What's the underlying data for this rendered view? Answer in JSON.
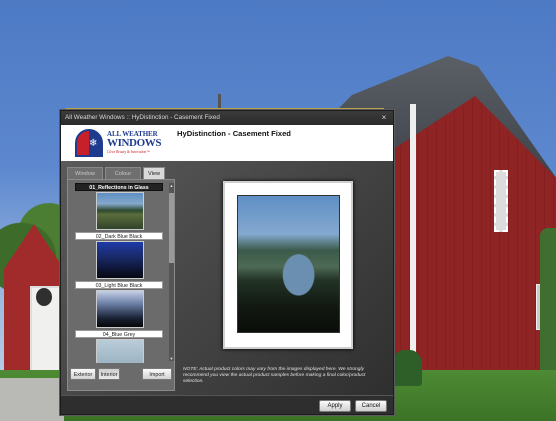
{
  "window": {
    "title": "All Weather Windows  ::  HyDistinction - Casement Fixed",
    "close_glyph": "×"
  },
  "header": {
    "logo_line1": "ALL WEATHER",
    "logo_line2": "WINDOWS",
    "logo_tagline": "Clear Beauty & Innovation™",
    "logo_icon": "snowflake-icon",
    "product_title": "HyDistinction - Casement Fixed"
  },
  "tabs": [
    {
      "label": "Window",
      "active": false
    },
    {
      "label": "Colour",
      "active": false
    },
    {
      "label": "View",
      "active": true
    }
  ],
  "views": [
    {
      "label": "01_Reflections in Glass",
      "selected": true
    },
    {
      "label": "02_Dark Blue Black",
      "selected": false
    },
    {
      "label": "03_Light Blue Black",
      "selected": false
    },
    {
      "label": "04_Blue Grey",
      "selected": false
    }
  ],
  "panel_buttons": {
    "exterior": "Exterior",
    "interior": "Interior",
    "import": "Import"
  },
  "note": "NOTE: Actual product colors may vary from the images displayed here. We strongly recommend you view the actual product samples before making a final color/product selection.",
  "footer": {
    "apply": "Apply",
    "cancel": "Cancel"
  },
  "scroll": {
    "up": "▲",
    "down": "▼"
  }
}
